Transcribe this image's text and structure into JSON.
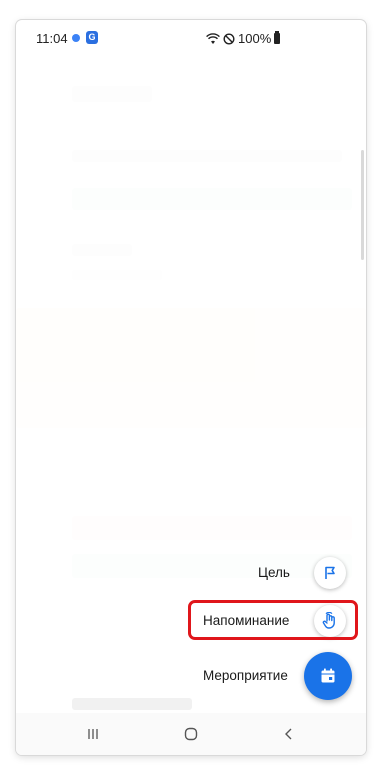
{
  "status_bar": {
    "time": "11:04",
    "app_badge": "G",
    "battery": "100%"
  },
  "fab_menu": {
    "items": [
      {
        "label": "Цель",
        "icon": "flag-icon"
      },
      {
        "label": "Напоминание",
        "icon": "reminder-hand-icon"
      },
      {
        "label": "Мероприятие",
        "icon": "calendar-event-icon"
      }
    ]
  },
  "colors": {
    "accent": "#1a73e8",
    "highlight": "#e0161b"
  },
  "nav_bar": {
    "items": [
      "recents-icon",
      "home-icon",
      "back-icon"
    ]
  }
}
